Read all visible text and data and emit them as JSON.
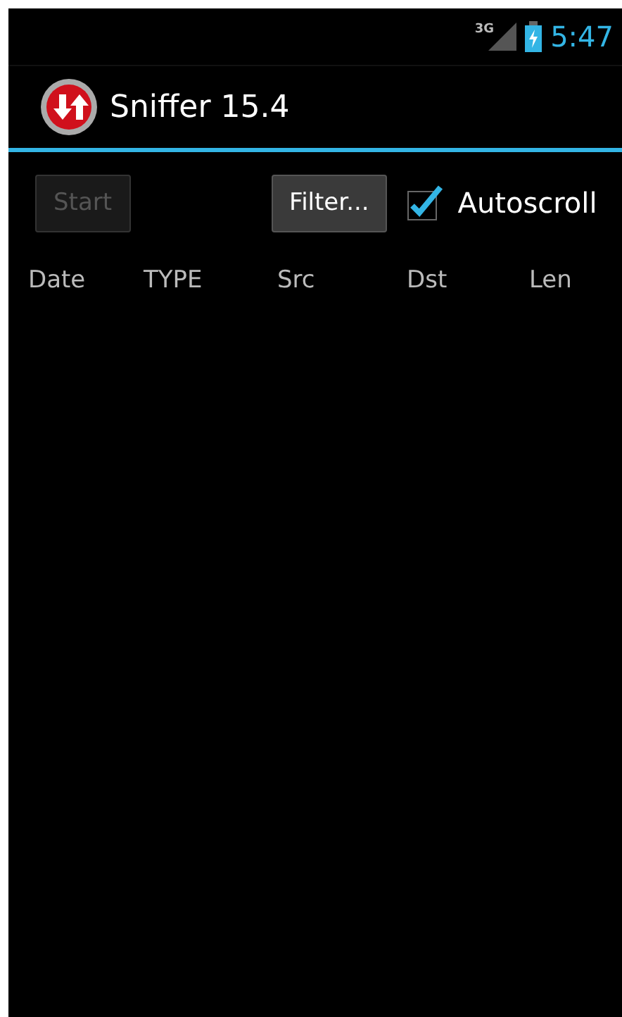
{
  "status_bar": {
    "network": "3G",
    "time": "5:47"
  },
  "action_bar": {
    "title": "Sniffer 15.4"
  },
  "toolbar": {
    "start": {
      "label": "Start",
      "disabled": true
    },
    "filter": {
      "label": "Filter..."
    },
    "autoscroll": {
      "label": "Autoscroll",
      "checked": true
    }
  },
  "table": {
    "columns": [
      "Date",
      "TYPE",
      "Src",
      "Dst",
      "Len"
    ]
  }
}
